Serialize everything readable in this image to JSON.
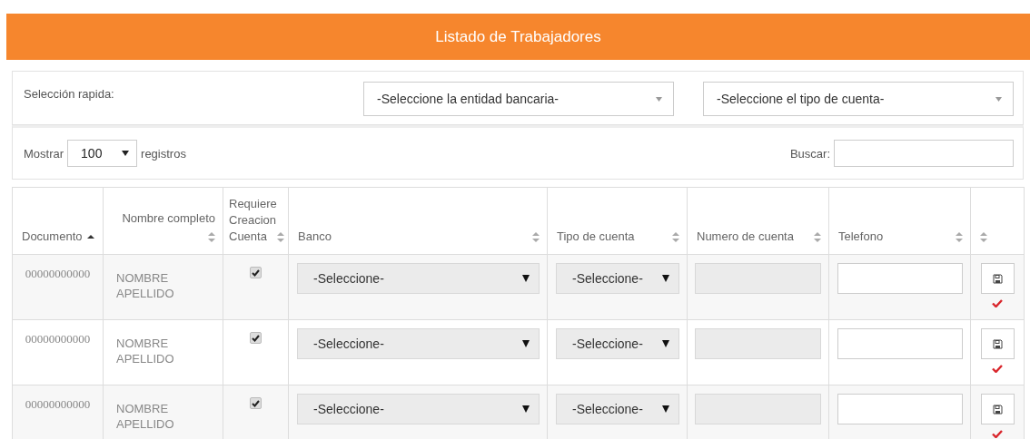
{
  "title": "Listado de Trabajadores",
  "quick_select": {
    "label": "Selección rapida:",
    "bank_placeholder": "-Seleccione la entidad bancaria-",
    "account_type_placeholder": "-Seleccione el tipo de cuenta-"
  },
  "length_control": {
    "prefix": "Mostrar",
    "value": "100",
    "suffix": "registros"
  },
  "search": {
    "label": "Buscar:"
  },
  "table": {
    "columns": [
      {
        "label": "Documento",
        "sorted_ascending": true
      },
      {
        "label": "Nombre completo",
        "sorted_ascending": false
      },
      {
        "label": "Requiere Creacion Cuenta",
        "sorted_ascending": false
      },
      {
        "label": "Banco",
        "sorted_ascending": false
      },
      {
        "label": "Tipo de cuenta",
        "sorted_ascending": false
      },
      {
        "label": "Numero de cuenta",
        "sorted_ascending": false
      },
      {
        "label": "Telefono",
        "sorted_ascending": false
      },
      {
        "sorted_ascending": false
      }
    ],
    "rows": [
      {
        "documento": "00000000000",
        "nombre": "NOMBRE APELLIDO",
        "requiere_cuenta": true,
        "banco": "-Seleccione-",
        "tipo_cuenta": "-Seleccione-",
        "saved": true
      },
      {
        "documento": "00000000000",
        "nombre": "NOMBRE APELLIDO",
        "requiere_cuenta": true,
        "banco": "-Seleccione-",
        "tipo_cuenta": "-Seleccione-",
        "saved": true
      },
      {
        "documento": "00000000000",
        "nombre": "NOMBRE APELLIDO",
        "requiere_cuenta": true,
        "banco": "-Seleccione-",
        "tipo_cuenta": "-Seleccione-",
        "saved": true
      }
    ]
  }
}
